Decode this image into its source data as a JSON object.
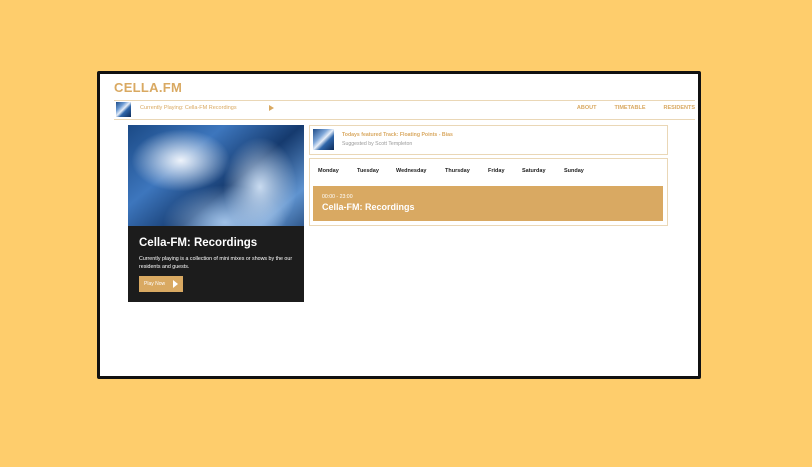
{
  "brand": {
    "logo": "CELLA.FM",
    "accent_color": "#d9a962",
    "background_color": "#fecd6c"
  },
  "player": {
    "now_playing": "Currently Playing: Cella-FM Recordings",
    "play_icon": "play-icon"
  },
  "nav": {
    "links": [
      "ABOUT",
      "TIMETABLE",
      "RESIDENTS"
    ]
  },
  "hero": {
    "title": "Cella-FM: Recordings",
    "description": "Currently playing is a collection of mini mixes or shows by the our residents and guests.",
    "button_label": "Play Now"
  },
  "featured": {
    "track": "Todays featured Track: Floating Points - Bias",
    "suggested_by": "Suggested by Scott Templeton"
  },
  "schedule": {
    "days": [
      "Monday",
      "Tuesday",
      "Wednesday",
      "Thursday",
      "Friday",
      "Saturday",
      "Sunday"
    ],
    "shows": [
      {
        "time": "00:00 - 23:00",
        "title": "Cella-FM: Recordings"
      }
    ]
  }
}
